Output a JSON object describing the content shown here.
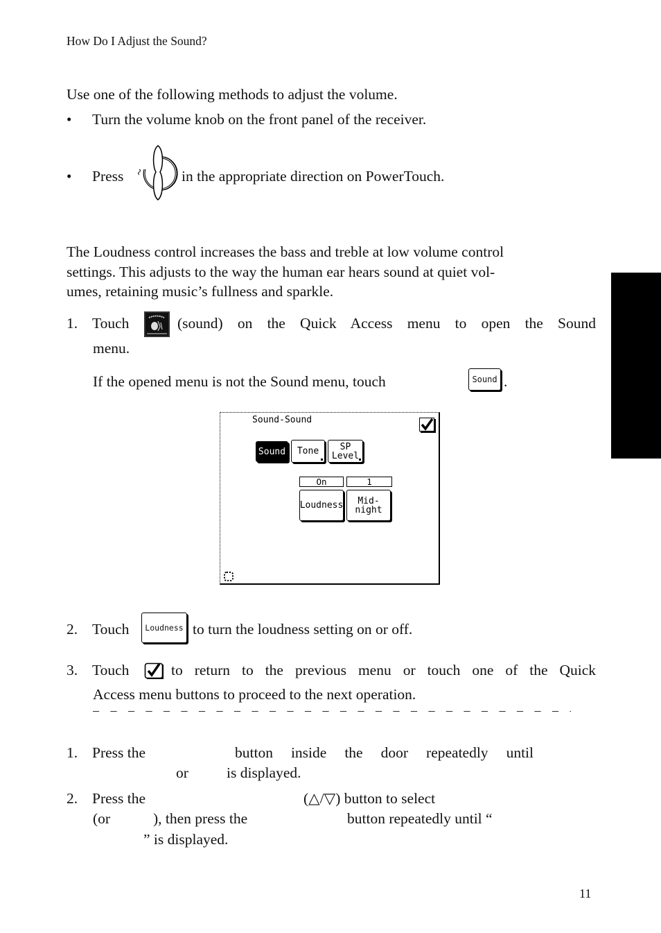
{
  "page": {
    "running_head": "How Do I Adjust the Sound?",
    "page_number": "11"
  },
  "volume_section": {
    "intro": "Use one of the following methods to adjust the volume.",
    "bullet_symbol": "•",
    "bullets": [
      {
        "text": "Turn the volume knob on the front panel of the receiver."
      },
      {
        "before": "Press",
        "icon": "volume-rocker-icon",
        "after": "in the appropriate direction on PowerTouch."
      }
    ]
  },
  "loudness_section": {
    "description": "The Loudness control increases the bass and treble at low volume control settings. This adjusts to the way the human ear hears sound at quiet vol-umes, retaining music’s fullness and sparkle.",
    "description_lines": [
      "The Loudness control increases the bass and treble at low volume control",
      "settings. This adjusts to the way the human ear hears sound at quiet vol-",
      "umes, retaining music’s fullness and sparkle."
    ],
    "steps": [
      {
        "num": "1.",
        "before": "Touch",
        "icon": "sound-icon",
        "line1_after": "(sound) on the Quick Access menu to open the Sound",
        "line2": "menu.",
        "note_before": "If the opened menu is not the Sound menu, touch",
        "note_button": "Sound",
        "note_after": "."
      },
      {
        "num": "2.",
        "before": "Touch",
        "button": "Loudness",
        "after": "to turn the loudness setting on or off."
      },
      {
        "num": "3.",
        "before": "Touch",
        "icon": "checkmark-icon",
        "line1_after": "to return to the previous menu or touch one of the Quick",
        "line2": "Access menu buttons to proceed to the next operation."
      }
    ],
    "dash_line": "– – – – – – – – – – – – – – – – – – – – – – – – – – – – – – – – –"
  },
  "screen": {
    "title": "Sound-Sound",
    "tabs": [
      {
        "label": "Sound",
        "active": true
      },
      {
        "label": "Tone",
        "active": false
      },
      {
        "label_line1": "SP",
        "label_line2": "Level",
        "active": false
      }
    ],
    "controls": [
      {
        "value": "On",
        "label": "Loudness"
      },
      {
        "value": "1",
        "label_line1": "Mid-",
        "label_line2": "night"
      }
    ]
  },
  "remote_section": {
    "steps": [
      {
        "num": "1.",
        "line1_a": "Press the",
        "line1_b": "button inside the door repeatedly until",
        "line2_a": "or",
        "line2_b": "is displayed."
      },
      {
        "num": "2.",
        "line1_a": "Press the",
        "line1_b": "(△/▽) button to select",
        "line2_a": "(or",
        "line2_b": "), then press the",
        "line2_c": "button repeatedly until “",
        "line3": "” is displayed."
      }
    ]
  }
}
